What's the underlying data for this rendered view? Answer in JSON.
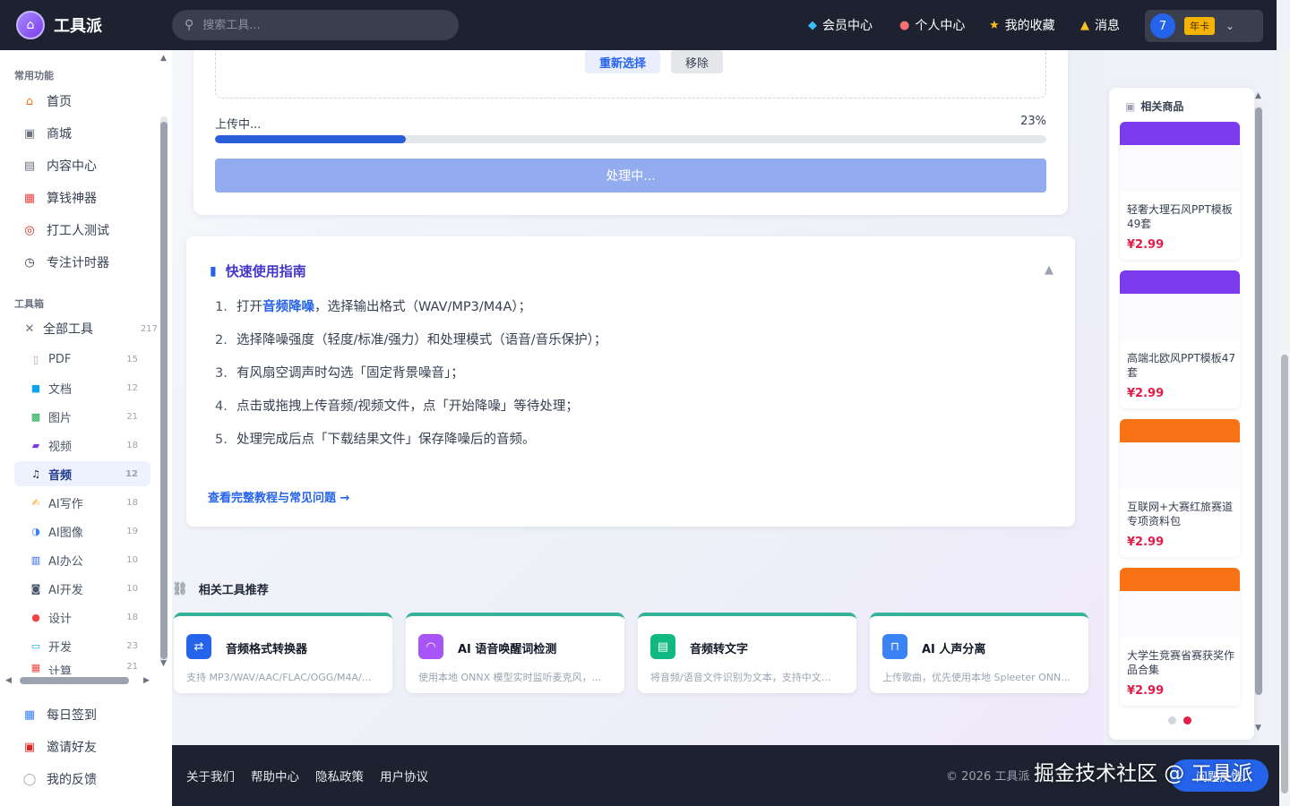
{
  "header": {
    "brand": "工具派",
    "search_placeholder": "搜索工具...",
    "nav": [
      {
        "label": "会员中心",
        "icon": "diamond-icon"
      },
      {
        "label": "个人中心",
        "icon": "person-icon"
      },
      {
        "label": "我的收藏",
        "icon": "star-icon"
      },
      {
        "label": "消息",
        "icon": "bell-icon"
      }
    ],
    "user": {
      "avatar_text": "7",
      "vip_label": "年卡"
    }
  },
  "sidebar": {
    "common_title": "常用功能",
    "common": [
      {
        "label": "首页",
        "icon": "home-icon"
      },
      {
        "label": "商城",
        "icon": "cart-icon"
      },
      {
        "label": "内容中心",
        "icon": "newspaper-icon"
      },
      {
        "label": "算钱神器",
        "icon": "calculator-icon"
      },
      {
        "label": "打工人测试",
        "icon": "target-icon"
      },
      {
        "label": "专注计时器",
        "icon": "stopwatch-icon"
      }
    ],
    "toolbox_title": "工具箱",
    "all_tools": {
      "label": "全部工具",
      "count": "217"
    },
    "categories": [
      {
        "label": "PDF",
        "count": "15"
      },
      {
        "label": "文档",
        "count": "12"
      },
      {
        "label": "图片",
        "count": "21"
      },
      {
        "label": "视频",
        "count": "18"
      },
      {
        "label": "音频",
        "count": "12"
      },
      {
        "label": "AI写作",
        "count": "18"
      },
      {
        "label": "AI图像",
        "count": "19"
      },
      {
        "label": "AI办公",
        "count": "10"
      },
      {
        "label": "AI开发",
        "count": "10"
      },
      {
        "label": "设计",
        "count": "18"
      },
      {
        "label": "开发",
        "count": "23"
      },
      {
        "label": "计算",
        "count": "21"
      }
    ],
    "bottom": [
      {
        "label": "每日签到",
        "icon": "calendar-icon"
      },
      {
        "label": "邀请好友",
        "icon": "gift-icon"
      },
      {
        "label": "我的反馈",
        "icon": "chat-icon"
      }
    ]
  },
  "upload": {
    "reselect": "重新选择",
    "remove": "移除",
    "status": "上传中...",
    "percent_text": "23%",
    "progress": 0.23,
    "process_button": "处理中..."
  },
  "guide": {
    "title": "快速使用指南",
    "steps": [
      {
        "num": "1.",
        "pre": "打开",
        "hl": "音频降噪",
        "post": "，选择输出格式（WAV/MP3/M4A）；"
      },
      {
        "num": "2.",
        "pre": "选择降噪强度（轻度/标准/强力）和处理模式（语音/音乐保护）；",
        "hl": "",
        "post": ""
      },
      {
        "num": "3.",
        "pre": "有风扇空调声时勾选「固定背景噪音」；",
        "hl": "",
        "post": ""
      },
      {
        "num": "4.",
        "pre": "点击或拖拽上传音频/视频文件，点「开始降噪」等待处理；",
        "hl": "",
        "post": ""
      },
      {
        "num": "5.",
        "pre": "处理完成后点「下载结果文件」保存降噪后的音频。",
        "hl": "",
        "post": ""
      }
    ],
    "link": "查看完整教程与常见问题 →"
  },
  "related": {
    "title": "相关工具推荐",
    "tools": [
      {
        "name": "音频格式转换器",
        "desc": "支持 MP3/WAV/AAC/FLAC/OGG/M4A/...",
        "color": "#2563eb"
      },
      {
        "name": "AI 语音唤醒词检测",
        "desc": "使用本地 ONNX 模型实时监听麦克风，...",
        "color": "#a855f7"
      },
      {
        "name": "音频转文字",
        "desc": "将音频/语音文件识别为文本，支持中文...",
        "color": "#10b981"
      },
      {
        "name": "AI 人声分离",
        "desc": "上传歌曲，优先使用本地 Spleeter ONN...",
        "color": "#3b82f6"
      }
    ]
  },
  "products": {
    "title": "相关商品",
    "items": [
      {
        "name": "轻奢大理石风PPT模板49套",
        "price": "¥2.99",
        "banner_color": "#7c3aed"
      },
      {
        "name": "高端北欧风PPT模板47套",
        "price": "¥2.99",
        "banner_color": "#7c3aed"
      },
      {
        "name": "互联网+大赛红旅赛道专项资料包",
        "price": "¥2.99",
        "banner_color": "#f97316"
      },
      {
        "name": "大学生竞赛省赛获奖作品合集",
        "price": "¥2.99",
        "banner_color": "#f97316"
      }
    ]
  },
  "footer": {
    "links": [
      "关于我们",
      "帮助中心",
      "隐私政策",
      "用户协议"
    ],
    "copyright": "© 2026 工具派",
    "watermark": "掘金技术社区 @ 工具派",
    "fab": "问题反馈"
  },
  "colors": {
    "accent": "#2563eb",
    "dark": "#1e2230",
    "price": "#e11d48"
  }
}
